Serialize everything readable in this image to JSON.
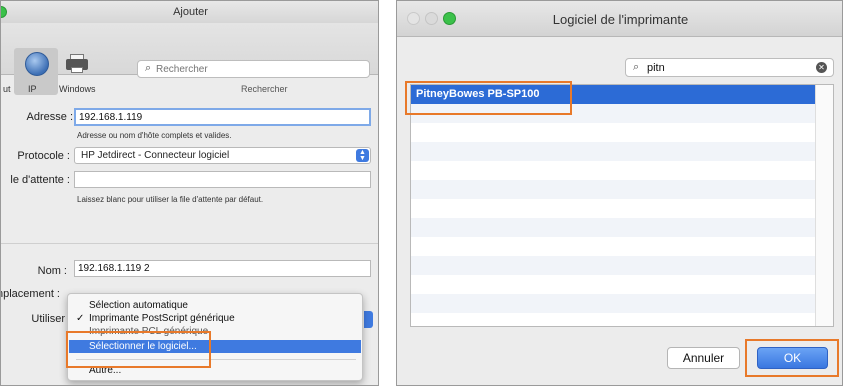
{
  "left_dialog": {
    "title": "Ajouter",
    "toolbar": {
      "items": [
        {
          "label": "ut",
          "icon": "default-icon"
        },
        {
          "label": "IP",
          "icon": "globe-icon"
        },
        {
          "label": "Windows",
          "icon": "printer-icon"
        }
      ],
      "search_placeholder": "Rechercher",
      "search_caption": "Rechercher"
    },
    "form": {
      "address_label": "Adresse :",
      "address_value": "192.168.1.119",
      "address_hint": "Adresse ou nom d'hôte complets et valides.",
      "protocol_label": "Protocole :",
      "protocol_value": "HP Jetdirect - Connecteur logiciel",
      "queue_label": "le d'attente :",
      "queue_value": "",
      "queue_hint": "Laissez blanc pour utiliser la file d'attente par défaut.",
      "name_label": "Nom :",
      "name_value": "192.168.1.119 2",
      "location_label": "nplacement :",
      "use_label": "Utiliser"
    },
    "use_menu": {
      "items": [
        {
          "label": "Sélection automatique",
          "checked": false,
          "state": "normal"
        },
        {
          "label": "Imprimante PostScript générique",
          "checked": true,
          "state": "normal"
        },
        {
          "label": "Imprimante PCL générique",
          "checked": false,
          "state": "dim"
        },
        {
          "label": "Sélectionner le logiciel...",
          "checked": false,
          "state": "highlighted"
        },
        {
          "label": "Autre...",
          "checked": false,
          "state": "normal"
        }
      ],
      "check_glyph": "✓"
    }
  },
  "right_dialog": {
    "title": "Logiciel de l'imprimante",
    "search_value": "pitn",
    "list": {
      "items": [
        "PitneyBowes PB-SP100"
      ],
      "selected_index": 0,
      "empty_rows": 11
    },
    "buttons": {
      "cancel": "Annuler",
      "ok": "OK"
    }
  },
  "colors": {
    "accent": "#3f7ae0",
    "selection": "#2c6bd6",
    "highlight_box": "#e8792a",
    "traffic_close": "#e4e4e4",
    "traffic_min": "#dadada",
    "traffic_zoom": "#3bc14a"
  }
}
